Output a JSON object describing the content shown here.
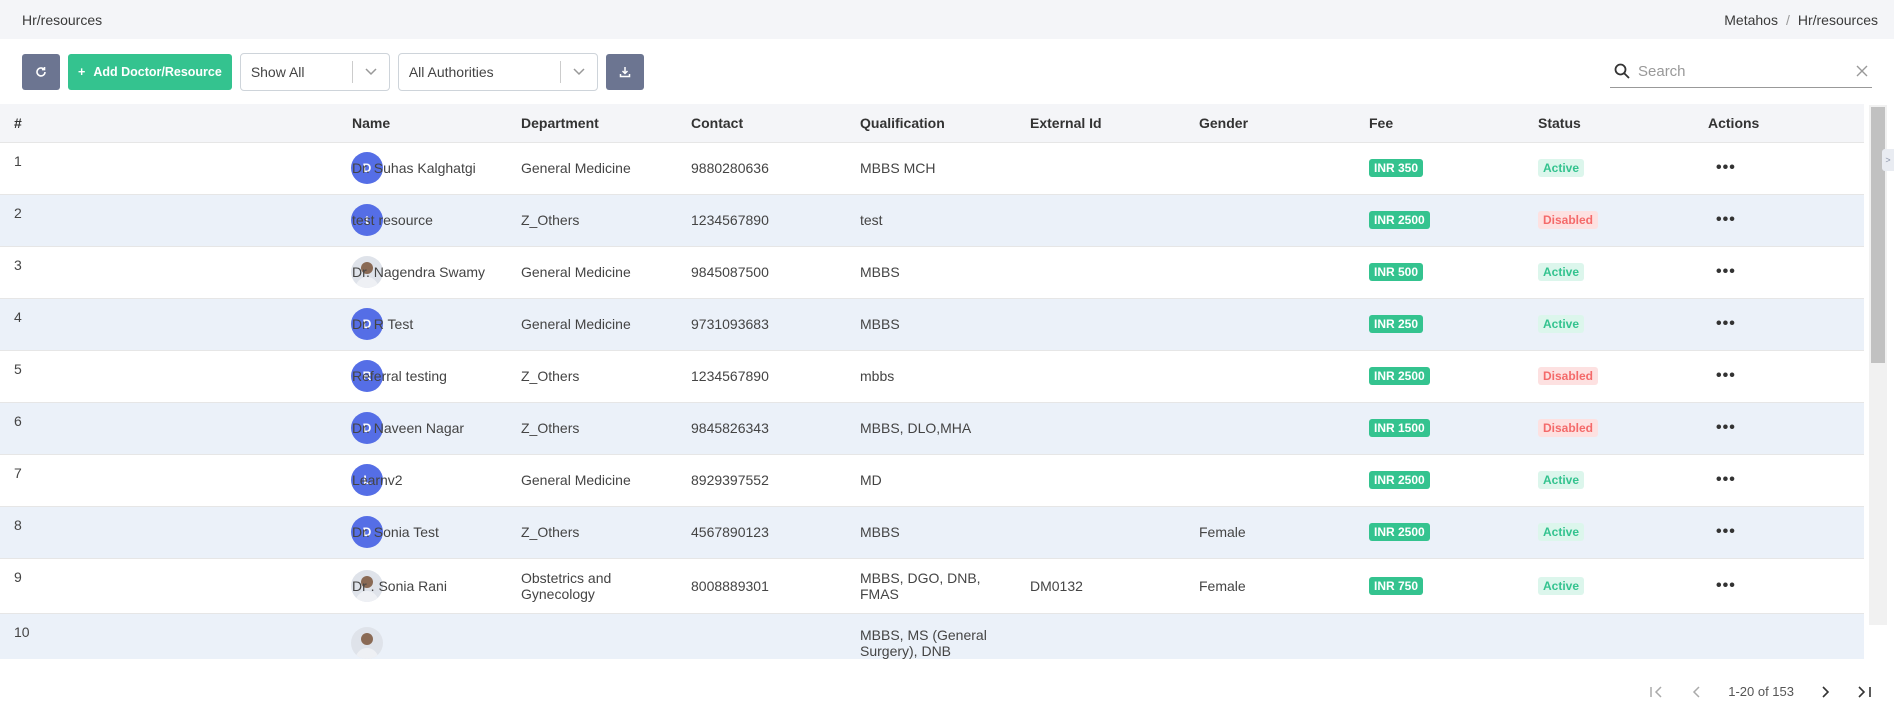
{
  "header": {
    "title": "Hr/resources",
    "breadcrumb": [
      "Metahos",
      "Hr/resources"
    ],
    "breadcrumb_sep": "/"
  },
  "toolbar": {
    "refresh_icon": "refresh-icon",
    "add_label": "Add Doctor/Resource",
    "add_prefix": "+",
    "filter_status": "Show All",
    "filter_authority": "All Authorities",
    "download_icon": "download-icon",
    "search_placeholder": "Search"
  },
  "columns": [
    "#",
    "",
    "Name",
    "Department",
    "Contact",
    "Qualification",
    "External Id",
    "Gender",
    "Fee",
    "Status",
    "Actions"
  ],
  "rows": [
    {
      "num": "1",
      "avatar": "D",
      "name": "Dr. Suhas Kalghatgi",
      "dept": "General Medicine",
      "contact": "9880280636",
      "qual": "MBBS MCH",
      "ext": "",
      "gender": "",
      "fee": "INR 350",
      "status": "Active"
    },
    {
      "num": "2",
      "avatar": "t",
      "name": "test resource",
      "dept": "Z_Others",
      "contact": "1234567890",
      "qual": "test",
      "ext": "",
      "gender": "",
      "fee": "INR 2500",
      "status": "Disabled"
    },
    {
      "num": "3",
      "avatar": "",
      "name": "Dr. Nagendra Swamy",
      "dept": "General Medicine",
      "contact": "9845087500",
      "qual": "MBBS",
      "ext": "",
      "gender": "",
      "fee": "INR 500",
      "status": "Active"
    },
    {
      "num": "4",
      "avatar": "D",
      "name": "Dr. R Test",
      "dept": "General Medicine",
      "contact": "9731093683",
      "qual": "MBBS",
      "ext": "",
      "gender": "",
      "fee": "INR 250",
      "status": "Active"
    },
    {
      "num": "5",
      "avatar": "R",
      "name": "Referral testing",
      "dept": "Z_Others",
      "contact": "1234567890",
      "qual": "mbbs",
      "ext": "",
      "gender": "",
      "fee": "INR 2500",
      "status": "Disabled"
    },
    {
      "num": "6",
      "avatar": "D",
      "name": "Dr. Naveen Nagar",
      "dept": "Z_Others",
      "contact": "9845826343",
      "qual": "MBBS, DLO,MHA",
      "ext": "",
      "gender": "",
      "fee": "INR 1500",
      "status": "Disabled"
    },
    {
      "num": "7",
      "avatar": "L",
      "name": "Learnv2",
      "dept": "General Medicine",
      "contact": "8929397552",
      "qual": "MD",
      "ext": "",
      "gender": "",
      "fee": "INR 2500",
      "status": "Active"
    },
    {
      "num": "8",
      "avatar": "D",
      "name": "Dr. Sonia Test",
      "dept": "Z_Others",
      "contact": "4567890123",
      "qual": "MBBS",
      "ext": "",
      "gender": "Female",
      "fee": "INR 2500",
      "status": "Active"
    },
    {
      "num": "9",
      "avatar": "",
      "name": "Dr . Sonia Rani",
      "dept": "Obstetrics and Gynecology",
      "contact": "8008889301",
      "qual": "MBBS, DGO, DNB, FMAS",
      "ext": "DM0132",
      "gender": "Female",
      "fee": "INR 750",
      "status": "Active"
    },
    {
      "num": "10",
      "avatar": "",
      "name": "",
      "dept": "",
      "contact": "",
      "qual": "MBBS, MS (General Surgery), DNB",
      "ext": "",
      "gender": "",
      "fee": "",
      "status": ""
    }
  ],
  "action_icon": "ellipsis-icon",
  "pager": {
    "range": "1-20 of 153"
  },
  "colors": {
    "primary": "#556ee6",
    "success": "#34c38f",
    "danger": "#f46a6a",
    "gray_button": "#6c7591"
  }
}
